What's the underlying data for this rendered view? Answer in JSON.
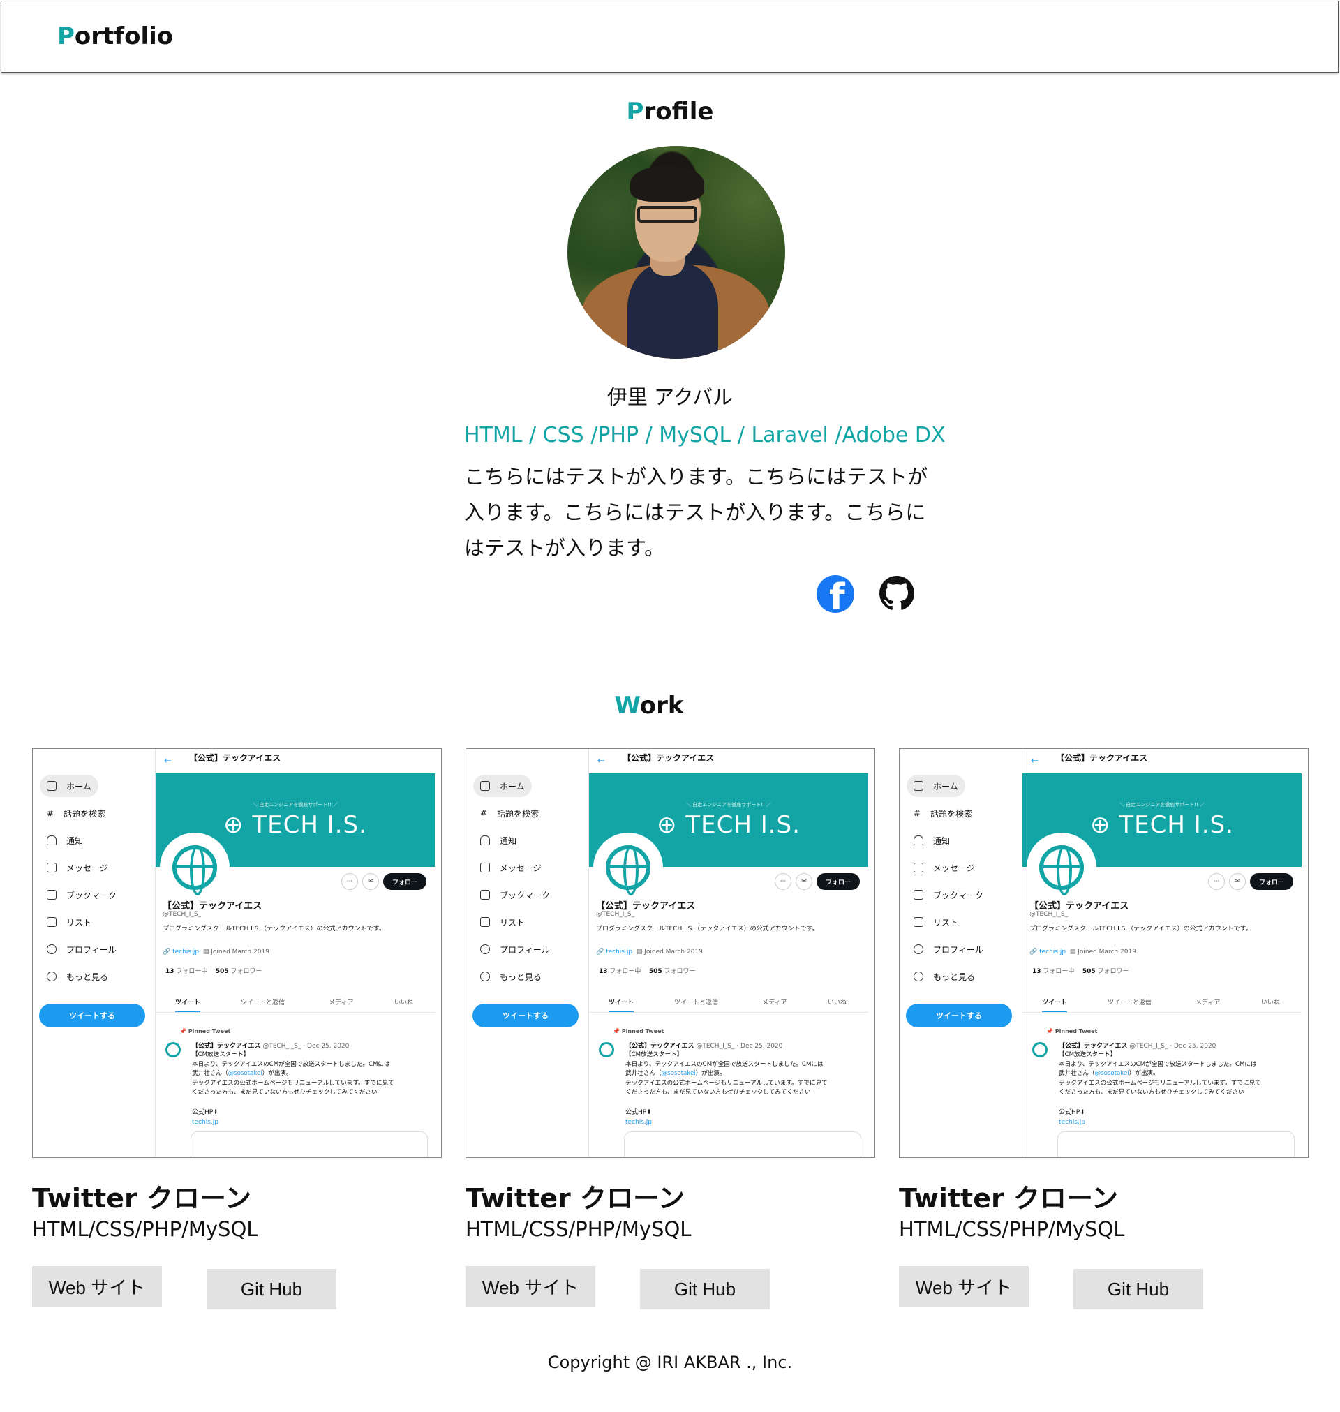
{
  "header": {
    "logo_first": "P",
    "logo_rest": "ortfolio"
  },
  "profile": {
    "title_first": "P",
    "title_rest": "rofile",
    "name": "伊里 アクバル",
    "skills": "HTML /  CSS /PHP / MySQL / Laravel /Adobe DX",
    "bio": "こちらにはテストが入ります。こちらにはテストが入ります。こちらにはテストが入ります。こちらにはテストが入ります。",
    "social": {
      "facebook_icon": "facebook-icon",
      "github_icon": "github-icon"
    }
  },
  "work": {
    "title_first": "W",
    "title_rest": "ork",
    "cards": [
      {
        "title": "Twitter クローン",
        "tech": "HTML/CSS/PHP/MySQL",
        "web_label": "Web サイト",
        "git_label": "Git Hub"
      },
      {
        "title": "Twitter クローン",
        "tech": "HTML/CSS/PHP/MySQL",
        "web_label": "Web サイト",
        "git_label": "Git Hub"
      },
      {
        "title": "Twitter クローン",
        "tech": "HTML/CSS/PHP/MySQL",
        "web_label": "Web サイト",
        "git_label": "Git Hub"
      }
    ]
  },
  "screenshot": {
    "top_title": "【公式】テックアイエス",
    "nav": [
      "ホーム",
      "話題を検索",
      "通知",
      "メッセージ",
      "ブックマーク",
      "リスト",
      "プロフィール",
      "もっと見る"
    ],
    "tweet_button": "ツイートする",
    "banner_sub": "＼ 自走エンジニアを徹底サポート!! ／",
    "banner_logo": "TECH I.S.",
    "follow": "フォロー",
    "more": "···",
    "mail": "✉",
    "profile_name": "【公式】テックアイエス",
    "handle": "@TECH_I_S_",
    "description": "プログラミングスクールTECH I.S.（テックアイエス）の公式アカウントです。",
    "site_link": "techis.jp",
    "joined": "Joined March 2019",
    "following_count": "13",
    "following_label": "フォロー中",
    "followers_count": "505",
    "followers_label": "フォロワー",
    "tabs": [
      "ツイート",
      "ツイートと返信",
      "メディア",
      "いいね"
    ],
    "pinned": "Pinned Tweet",
    "tweet_author": "【公式】テックアイエス",
    "tweet_meta": "@TECH_I_S_ · Dec 25, 2020",
    "tweet_line1": "【CM放送スタート】",
    "tweet_line2": "本日より、テックアイエスのCMが全国で放送スタートしました。CMには",
    "tweet_line3a": "武井壮さん（",
    "tweet_mention": "@sosotakei",
    "tweet_line3b": "）が出演。",
    "tweet_line4": "テックアイエスの公式ホームページもリニューアルしています。すでに見て",
    "tweet_line5": "くださった方も、まだ見ていない方もぜひチェックしてみてください",
    "tweet_hp": "公式HP⬇",
    "tweet_link": "techis.jp"
  },
  "footer": {
    "copyright": "Copyright @ IRI AKBAR ., Inc."
  },
  "colors": {
    "accent": "#13a5a5",
    "facebook": "#1877f2",
    "twitter_blue": "#1d9bf0",
    "button_bg": "#e2e2e2"
  }
}
